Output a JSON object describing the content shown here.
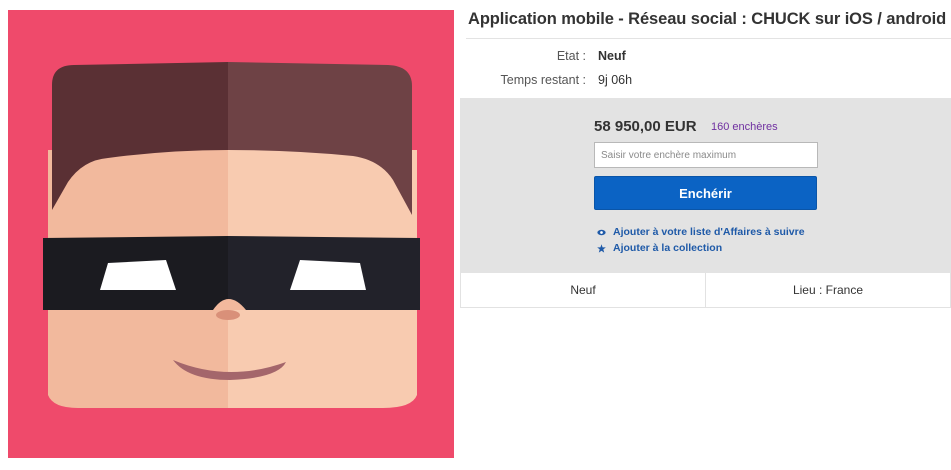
{
  "listing": {
    "title": "Application mobile - Réseau social : CHUCK sur iOS / android",
    "image_icon": "masked-face-avatar"
  },
  "details": {
    "condition_label": "Etat :",
    "condition_value": "Neuf",
    "time_label": "Temps restant :",
    "time_value": "9j 06h"
  },
  "bidding": {
    "price": "58 950,00 EUR",
    "bid_count": "160 enchères",
    "input_placeholder": "Saisir votre enchère maximum",
    "bid_button": "Enchérir",
    "watchlist_link": "Ajouter à votre liste d'Affaires à suivre",
    "watchlist_icon": "eye-icon",
    "collection_link": "Ajouter à la collection",
    "collection_icon": "star-icon"
  },
  "info_strip": {
    "condition": "Neuf",
    "location": "Lieu : France"
  },
  "colors": {
    "image_background": "#ef4a6b",
    "bid_button": "#0b63c4",
    "link_blue": "#1f5aa8",
    "bid_count_purple": "#6f2fa0",
    "panel_gray": "#e3e3e3"
  }
}
